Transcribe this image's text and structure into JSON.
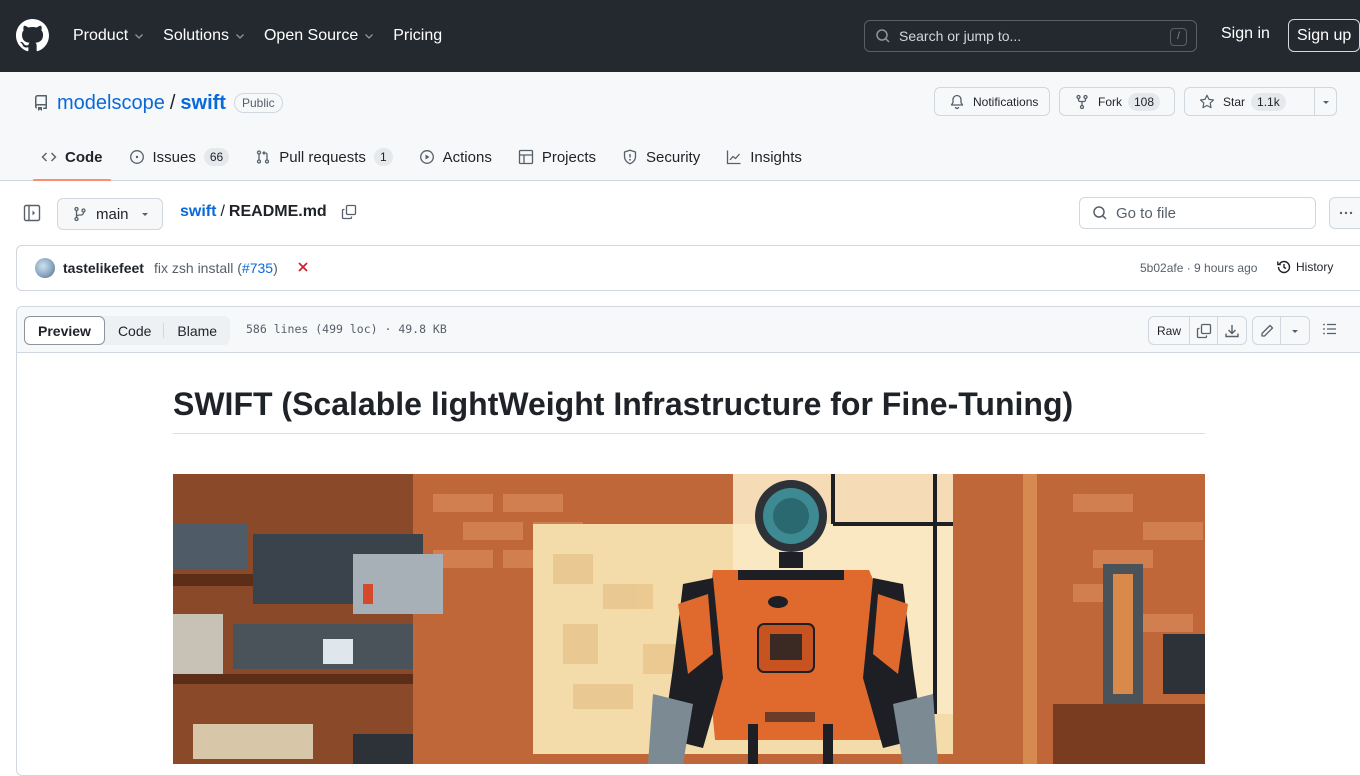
{
  "header": {
    "nav": [
      {
        "label": "Product",
        "has_dropdown": true
      },
      {
        "label": "Solutions",
        "has_dropdown": true
      },
      {
        "label": "Open Source",
        "has_dropdown": true
      },
      {
        "label": "Pricing",
        "has_dropdown": false
      }
    ],
    "search_placeholder": "Search or jump to...",
    "search_shortcut": "/",
    "sign_in": "Sign in",
    "sign_up": "Sign up"
  },
  "repo": {
    "owner": "modelscope",
    "separator": "/",
    "name": "swift",
    "visibility": "Public",
    "notifications_label": "Notifications",
    "fork_label": "Fork",
    "fork_count": "108",
    "star_label": "Star",
    "star_count": "1.1k",
    "tabs": [
      {
        "label": "Code",
        "icon": "code-icon",
        "active": true
      },
      {
        "label": "Issues",
        "icon": "issue-icon",
        "count": "66"
      },
      {
        "label": "Pull requests",
        "icon": "pull-request-icon",
        "count": "1"
      },
      {
        "label": "Actions",
        "icon": "play-icon"
      },
      {
        "label": "Projects",
        "icon": "table-icon"
      },
      {
        "label": "Security",
        "icon": "shield-icon"
      },
      {
        "label": "Insights",
        "icon": "graph-icon"
      }
    ]
  },
  "filebar": {
    "branch": "main",
    "path_root": "swift",
    "path_sep": "/",
    "file_name": "README.md",
    "goto_placeholder": "Go to file"
  },
  "commit": {
    "author": "tastelikefeet",
    "message": "fix zsh install (",
    "pr": "#735",
    "message_end": ")",
    "status": "failed",
    "sha_time": "5b02afe · 9 hours ago",
    "history_label": "History"
  },
  "viewer": {
    "tabs": [
      {
        "label": "Preview",
        "active": true
      },
      {
        "label": "Code"
      },
      {
        "label": "Blame"
      }
    ],
    "stats": "586 lines (499 loc) · 49.8 KB",
    "raw_label": "Raw"
  },
  "readme": {
    "title": "SWIFT (Scalable lightWeight Infrastructure for Fine-Tuning)",
    "banner_alt": "Illustration of an orange robot standing in a brick-walled workshop"
  }
}
